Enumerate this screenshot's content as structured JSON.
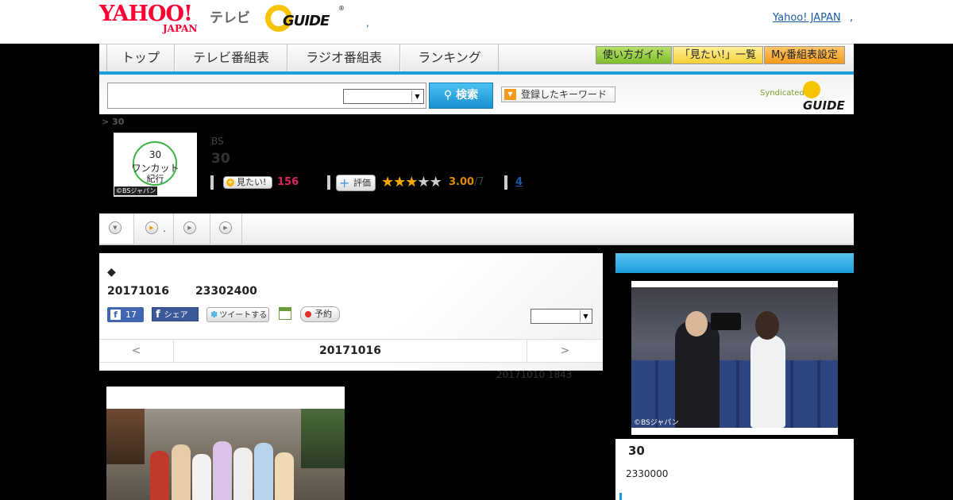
{
  "header": {
    "yahoo_logo": "YAHOO!",
    "yahoo_sub": "JAPAN",
    "tv_label": "テレビ",
    "gguide_logo": "GUIDE",
    "gguide_reg": "®",
    "yahoo_japan_link": "Yahoo! JAPAN",
    "dot_link": ",",
    "dot_link2": ","
  },
  "nav": {
    "tabs": [
      "トップ",
      "テレビ番組表",
      "ラジオ番組表",
      "ランキング"
    ],
    "right_buttons": [
      "使い方ガイド",
      "「見たい!」一覧",
      "My番組表設定"
    ]
  },
  "search": {
    "input_value": "",
    "select_value": "",
    "search_button": "検索",
    "keyword_button": "登録したキーワード",
    "syndicated": "Syndicated",
    "syndicated_logo": "GUIDE"
  },
  "breadcrumb": "> 30",
  "program": {
    "thumb_line1": "30",
    "thumb_line2": "ワンカット",
    "thumb_line3": "紀行",
    "thumb_credit": "©BSジャパン",
    "channel": "BS",
    "title": "30",
    "mitai_label": "見たい!",
    "mitai_count": "156",
    "hyoka_label": "評価",
    "rating_stars": 3,
    "rating_value": "3.00",
    "rating_count": "/7",
    "review_link": "4"
  },
  "tabbar": {
    "tab2_label": "."
  },
  "main": {
    "diamond": "◆",
    "date": "20171016",
    "time": "23302400",
    "fb_like_count": "17",
    "fb_share": "シェア",
    "tweet": "ツイートする",
    "reserve": "予約",
    "select_value": "",
    "pager_prev": "<",
    "pager_date": "20171016",
    "pager_next": ">",
    "update_line": "20171010  1843"
  },
  "sidebar": {
    "photo_credit": "©BSジャパン",
    "title": "30",
    "time": "2330000"
  }
}
